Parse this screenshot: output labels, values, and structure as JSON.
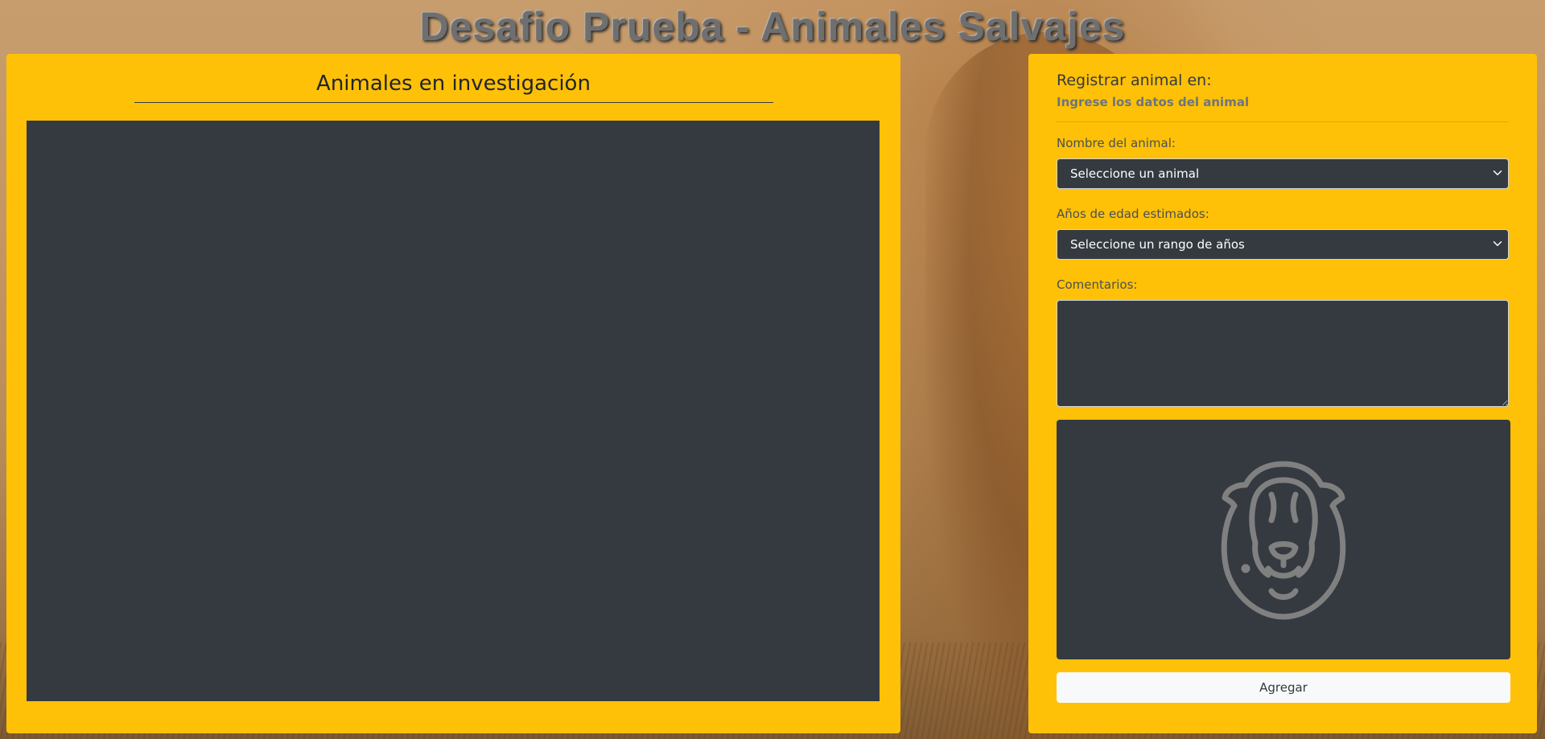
{
  "header": {
    "title": "Desafio Prueba - Animales Salvajes"
  },
  "research_panel": {
    "heading": "Animales en investigación"
  },
  "register_form": {
    "title": "Registrar animal en:",
    "subtitle": "Ingrese los datos del animal",
    "animal_name": {
      "label": "Nombre del animal:",
      "selected": "Seleccione un animal"
    },
    "age": {
      "label": "Años de edad estimados:",
      "selected": "Seleccione un rango de años"
    },
    "comments": {
      "label": "Comentarios:",
      "value": ""
    },
    "preview": {
      "icon": "lion-icon"
    },
    "submit_label": "Agregar"
  },
  "colors": {
    "panel": "#ffc107",
    "dark": "#343a40",
    "button": "#f8f9fa",
    "muted": "#6c757d",
    "icon_stroke": "#808080"
  }
}
